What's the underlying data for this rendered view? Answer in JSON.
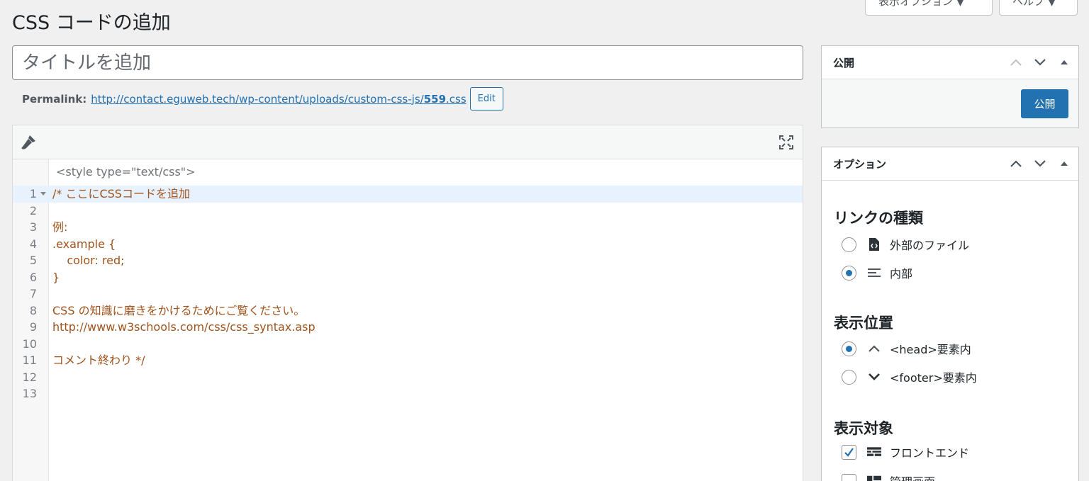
{
  "screen_meta": {
    "screen_options_label": "表示オプション ▼",
    "help_label": "ヘルプ ▼"
  },
  "page": {
    "title": "CSS コードの追加",
    "title_placeholder": "タイトルを追加"
  },
  "permalink": {
    "label": "Permalink:",
    "url_prefix": "http://contact.eguweb.tech/wp-content/uploads/custom-css-js/",
    "url_slug": "559",
    "url_suffix": ".css",
    "edit_label": "Edit"
  },
  "editor": {
    "style_tag": "<style type=\"text/css\">",
    "lines": [
      {
        "num": "1",
        "text": "/* ここにCSSコードを追加"
      },
      {
        "num": "2",
        "text": ""
      },
      {
        "num": "3",
        "text": "例:"
      },
      {
        "num": "4",
        "text": ".example {"
      },
      {
        "num": "5",
        "text": "    color: red;"
      },
      {
        "num": "6",
        "text": "}"
      },
      {
        "num": "7",
        "text": ""
      },
      {
        "num": "8",
        "text": "CSS の知識に磨きをかけるためにご覧ください。"
      },
      {
        "num": "9",
        "text": "http://www.w3schools.com/css/css_syntax.asp"
      },
      {
        "num": "10",
        "text": ""
      },
      {
        "num": "11",
        "text": "コメント終わり */"
      },
      {
        "num": "12",
        "text": ""
      },
      {
        "num": "13",
        "text": ""
      }
    ]
  },
  "publish_box": {
    "title": "公開",
    "button_label": "公開"
  },
  "options_box": {
    "title": "オプション",
    "link_type": {
      "heading": "リンクの種類",
      "options": [
        {
          "label": "外部のファイル",
          "selected": false,
          "icon": "file-code-icon"
        },
        {
          "label": "内部",
          "selected": true,
          "icon": "text-lines-icon"
        }
      ]
    },
    "position": {
      "heading": "表示位置",
      "options": [
        {
          "label": "<head>要素内",
          "selected": true,
          "icon": "chevron-up-icon"
        },
        {
          "label": "<footer>要素内",
          "selected": false,
          "icon": "chevron-down-icon"
        }
      ]
    },
    "target": {
      "heading": "表示対象",
      "options": [
        {
          "label": "フロントエンド",
          "checked": true,
          "icon": "frontend-layout-icon"
        },
        {
          "label": "管理画面",
          "checked": false,
          "icon": "admin-layout-icon"
        }
      ]
    }
  },
  "colors": {
    "accent": "#2271b1",
    "code_text": "#a0531c",
    "active_line": "#e8f2fe"
  }
}
